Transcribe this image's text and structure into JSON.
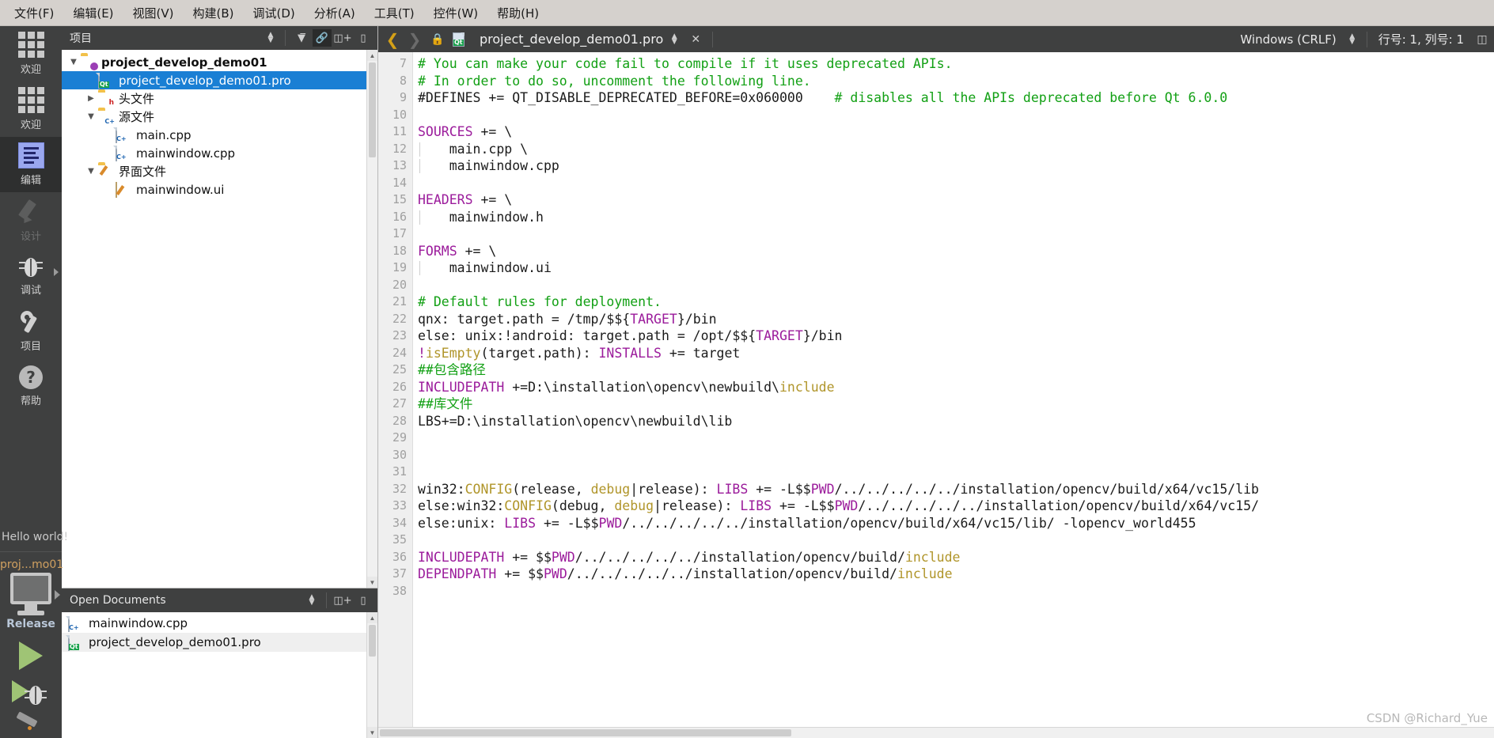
{
  "menubar": {
    "items": [
      {
        "label": "文件(F)",
        "name": "menu-file"
      },
      {
        "label": "编辑(E)",
        "name": "menu-edit"
      },
      {
        "label": "视图(V)",
        "name": "menu-view"
      },
      {
        "label": "构建(B)",
        "name": "menu-build"
      },
      {
        "label": "调试(D)",
        "name": "menu-debug"
      },
      {
        "label": "分析(A)",
        "name": "menu-analyze"
      },
      {
        "label": "工具(T)",
        "name": "menu-tools"
      },
      {
        "label": "控件(W)",
        "name": "menu-widgets"
      },
      {
        "label": "帮助(H)",
        "name": "menu-help"
      }
    ]
  },
  "modebar": {
    "modes": [
      {
        "label": "欢迎",
        "icon": "grid-icon",
        "state": "normal"
      },
      {
        "label": "欢迎",
        "icon": "grid-icon",
        "state": "normal"
      },
      {
        "label": "编辑",
        "icon": "edit-icon",
        "state": "active"
      },
      {
        "label": "设计",
        "icon": "pencil-icon",
        "state": "disabled"
      },
      {
        "label": "调试",
        "icon": "bug-icon",
        "state": "normal"
      },
      {
        "label": "项目",
        "icon": "wrench-icon",
        "state": "normal"
      },
      {
        "label": "帮助",
        "icon": "help-icon",
        "state": "normal"
      }
    ],
    "kit": {
      "hello": "Hello world!",
      "project": "proj...mo01",
      "build_config": "Release"
    }
  },
  "project_panel": {
    "header_title": "项目",
    "tree": [
      {
        "label": "project_develop_demo01",
        "depth": 0,
        "twist": "open",
        "icon": "folder-project-icon",
        "selected": false,
        "bold": true
      },
      {
        "label": "project_develop_demo01.pro",
        "depth": 1,
        "twist": "none",
        "icon": "qt-pro-file-icon",
        "selected": true,
        "bold": false
      },
      {
        "label": "头文件",
        "depth": 1,
        "twist": "closed",
        "icon": "folder-headers-icon",
        "selected": false,
        "bold": false
      },
      {
        "label": "源文件",
        "depth": 1,
        "twist": "open",
        "icon": "folder-sources-icon",
        "selected": false,
        "bold": false
      },
      {
        "label": "main.cpp",
        "depth": 2,
        "twist": "none",
        "icon": "cpp-file-icon",
        "selected": false,
        "bold": false
      },
      {
        "label": "mainwindow.cpp",
        "depth": 2,
        "twist": "none",
        "icon": "cpp-file-icon",
        "selected": false,
        "bold": false
      },
      {
        "label": "界面文件",
        "depth": 1,
        "twist": "open",
        "icon": "folder-forms-icon",
        "selected": false,
        "bold": false
      },
      {
        "label": "mainwindow.ui",
        "depth": 2,
        "twist": "none",
        "icon": "ui-file-icon",
        "selected": false,
        "bold": false
      }
    ]
  },
  "open_documents": {
    "header_title": "Open Documents",
    "items": [
      {
        "label": "mainwindow.cpp",
        "icon": "cpp-file-icon",
        "current": false
      },
      {
        "label": "project_develop_demo01.pro",
        "icon": "qt-pro-file-icon",
        "current": true
      }
    ]
  },
  "editor_toolbar": {
    "filename": "project_develop_demo01.pro",
    "eol": "Windows (CRLF)",
    "line_col": "行号: 1, 列号: 1"
  },
  "editor": {
    "first_line_number": 7,
    "lines": [
      {
        "n": 7,
        "tokens": [
          {
            "t": "# You can make your code fail to compile if it uses deprecated APIs.",
            "c": "c-com"
          }
        ]
      },
      {
        "n": 8,
        "tokens": [
          {
            "t": "# In order to do so, uncomment the following line.",
            "c": "c-com"
          }
        ]
      },
      {
        "n": 9,
        "tokens": [
          {
            "t": "#DEFINES += QT_DISABLE_DEPRECATED_BEFORE=0x060000",
            "c": ""
          },
          {
            "t": "    ",
            "c": ""
          },
          {
            "t": "# disables all the APIs deprecated before Qt 6.0.0",
            "c": "c-com"
          }
        ]
      },
      {
        "n": 10,
        "tokens": []
      },
      {
        "n": 11,
        "tokens": [
          {
            "t": "SOURCES",
            "c": "c-var"
          },
          {
            "t": " += \\",
            "c": ""
          }
        ]
      },
      {
        "n": 12,
        "tokens": [
          {
            "t": "    main.cpp \\",
            "c": ""
          }
        ]
      },
      {
        "n": 13,
        "tokens": [
          {
            "t": "    mainwindow.cpp",
            "c": ""
          }
        ]
      },
      {
        "n": 14,
        "tokens": []
      },
      {
        "n": 15,
        "tokens": [
          {
            "t": "HEADERS",
            "c": "c-var"
          },
          {
            "t": " += \\",
            "c": ""
          }
        ]
      },
      {
        "n": 16,
        "tokens": [
          {
            "t": "    mainwindow.h",
            "c": ""
          }
        ]
      },
      {
        "n": 17,
        "tokens": []
      },
      {
        "n": 18,
        "tokens": [
          {
            "t": "FORMS",
            "c": "c-var"
          },
          {
            "t": " += \\",
            "c": ""
          }
        ]
      },
      {
        "n": 19,
        "tokens": [
          {
            "t": "    mainwindow.ui",
            "c": ""
          }
        ]
      },
      {
        "n": 20,
        "tokens": []
      },
      {
        "n": 21,
        "tokens": [
          {
            "t": "# Default rules for deployment.",
            "c": "c-com"
          }
        ]
      },
      {
        "n": 22,
        "tokens": [
          {
            "t": "qnx: target.path = /tmp/$${",
            "c": ""
          },
          {
            "t": "TARGET",
            "c": "c-var"
          },
          {
            "t": "}/bin",
            "c": ""
          }
        ]
      },
      {
        "n": 23,
        "tokens": [
          {
            "t": "else: unix:!android: target.path = /opt/$${",
            "c": ""
          },
          {
            "t": "TARGET",
            "c": "c-var"
          },
          {
            "t": "}/bin",
            "c": ""
          }
        ]
      },
      {
        "n": 24,
        "tokens": [
          {
            "t": "!",
            "c": "c-var"
          },
          {
            "t": "isEmpty",
            "c": "c-fn"
          },
          {
            "t": "(target.path): ",
            "c": ""
          },
          {
            "t": "INSTALLS",
            "c": "c-var"
          },
          {
            "t": " += target",
            "c": ""
          }
        ]
      },
      {
        "n": 25,
        "tokens": [
          {
            "t": "##包含路径",
            "c": "c-com"
          }
        ]
      },
      {
        "n": 26,
        "tokens": [
          {
            "t": "INCLUDEPATH",
            "c": "c-var"
          },
          {
            "t": " +=D:\\installation\\opencv\\newbuild\\",
            "c": ""
          },
          {
            "t": "include",
            "c": "c-fn"
          }
        ]
      },
      {
        "n": 27,
        "tokens": [
          {
            "t": "##库文件",
            "c": "c-com"
          }
        ]
      },
      {
        "n": 28,
        "tokens": [
          {
            "t": "LBS+=D:\\installation\\opencv\\newbuild\\lib",
            "c": ""
          }
        ]
      },
      {
        "n": 29,
        "tokens": []
      },
      {
        "n": 30,
        "tokens": []
      },
      {
        "n": 31,
        "tokens": []
      },
      {
        "n": 32,
        "tokens": [
          {
            "t": "win32:",
            "c": ""
          },
          {
            "t": "CONFIG",
            "c": "c-fn"
          },
          {
            "t": "(release, ",
            "c": ""
          },
          {
            "t": "debug",
            "c": "c-fn"
          },
          {
            "t": "|release): ",
            "c": ""
          },
          {
            "t": "LIBS",
            "c": "c-var"
          },
          {
            "t": " += -L$$",
            "c": ""
          },
          {
            "t": "PWD",
            "c": "c-var"
          },
          {
            "t": "/../../../../../installation/opencv/build/x64/vc15/lib",
            "c": ""
          }
        ]
      },
      {
        "n": 33,
        "tokens": [
          {
            "t": "else:win32:",
            "c": ""
          },
          {
            "t": "CONFIG",
            "c": "c-fn"
          },
          {
            "t": "(debug, ",
            "c": ""
          },
          {
            "t": "debug",
            "c": "c-fn"
          },
          {
            "t": "|release): ",
            "c": ""
          },
          {
            "t": "LIBS",
            "c": "c-var"
          },
          {
            "t": " += -L$$",
            "c": ""
          },
          {
            "t": "PWD",
            "c": "c-var"
          },
          {
            "t": "/../../../../../installation/opencv/build/x64/vc15/",
            "c": ""
          }
        ]
      },
      {
        "n": 34,
        "tokens": [
          {
            "t": "else:unix: ",
            "c": ""
          },
          {
            "t": "LIBS",
            "c": "c-var"
          },
          {
            "t": " += -L$$",
            "c": ""
          },
          {
            "t": "PWD",
            "c": "c-var"
          },
          {
            "t": "/../../../../../installation/opencv/build/x64/vc15/lib/ -lopencv_world455",
            "c": ""
          }
        ]
      },
      {
        "n": 35,
        "tokens": []
      },
      {
        "n": 36,
        "tokens": [
          {
            "t": "INCLUDEPATH",
            "c": "c-var"
          },
          {
            "t": " += $$",
            "c": ""
          },
          {
            "t": "PWD",
            "c": "c-var"
          },
          {
            "t": "/../../../../../installation/opencv/build/",
            "c": ""
          },
          {
            "t": "include",
            "c": "c-fn"
          }
        ]
      },
      {
        "n": 37,
        "tokens": [
          {
            "t": "DEPENDPATH",
            "c": "c-var"
          },
          {
            "t": " += $$",
            "c": ""
          },
          {
            "t": "PWD",
            "c": "c-var"
          },
          {
            "t": "/../../../../../installation/opencv/build/",
            "c": ""
          },
          {
            "t": "include",
            "c": "c-fn"
          }
        ]
      },
      {
        "n": 38,
        "tokens": []
      }
    ]
  },
  "watermark": "CSDN @Richard_Yue",
  "colors": {
    "menubar_bg": "#d5d1cd",
    "dark_chrome": "#3f4040",
    "selection_blue": "#1a7fd4",
    "comment_green": "#12a014",
    "variable_purple": "#9b1b9b",
    "function_yellow": "#b0952a",
    "kit_orange": "#d0a060",
    "run_green": "#9fc475"
  }
}
